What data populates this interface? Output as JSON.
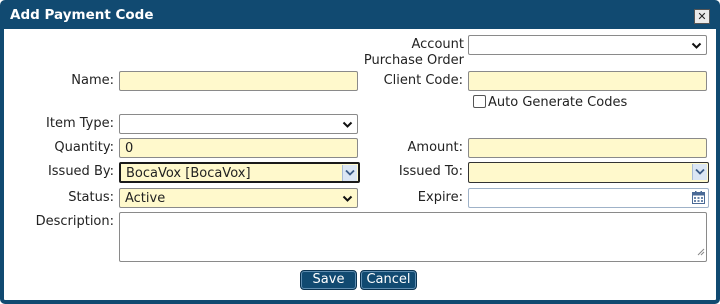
{
  "dialog": {
    "title": "Add Payment Code",
    "close_glyph": "✕"
  },
  "form": {
    "account": {
      "label_line1": "Account",
      "label_line2": "Purchase Order",
      "value": ""
    },
    "name": {
      "label": "Name:",
      "value": ""
    },
    "client_code": {
      "label": "Client Code:",
      "value": ""
    },
    "auto_generate": {
      "label": "Auto Generate Codes",
      "checked": false
    },
    "item_type": {
      "label": "Item Type:",
      "value": ""
    },
    "quantity": {
      "label": "Quantity:",
      "value": "0"
    },
    "amount": {
      "label": "Amount:",
      "value": ""
    },
    "issued_by": {
      "label": "Issued By:",
      "value": "BocaVox [BocaVox]"
    },
    "issued_to": {
      "label": "Issued To:",
      "value": ""
    },
    "status": {
      "label": "Status:",
      "value": "Active"
    },
    "expire": {
      "label": "Expire:",
      "value": ""
    },
    "description": {
      "label": "Description:",
      "value": ""
    }
  },
  "buttons": {
    "save": "Save",
    "cancel": "Cancel"
  },
  "icons": {
    "close": "close-icon",
    "dropdown": "chevron-down-icon",
    "calendar": "calendar-icon"
  }
}
